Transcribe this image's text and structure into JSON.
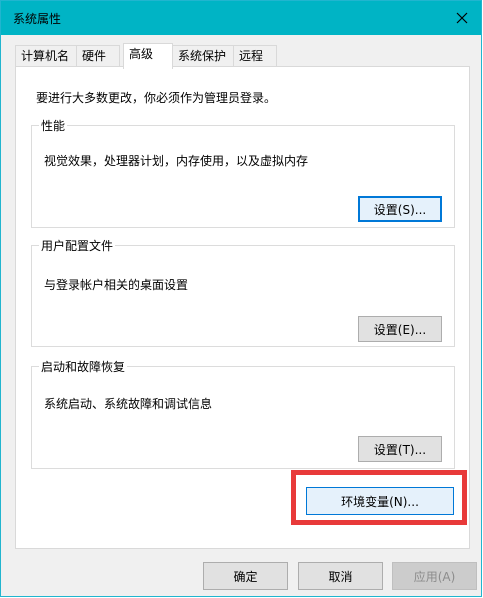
{
  "window": {
    "title": "系统属性"
  },
  "tabs": [
    {
      "label": "计算机名"
    },
    {
      "label": "硬件"
    },
    {
      "label": "高级"
    },
    {
      "label": "系统保护"
    },
    {
      "label": "远程"
    }
  ],
  "panel": {
    "notice": "要进行大多数更改，你必须作为管理员登录。",
    "performance": {
      "title": "性能",
      "desc": "视觉效果，处理器计划，内存使用，以及虚拟内存",
      "button": "设置(S)..."
    },
    "profiles": {
      "title": "用户配置文件",
      "desc": "与登录帐户相关的桌面设置",
      "button": "设置(E)..."
    },
    "startup": {
      "title": "启动和故障恢复",
      "desc": "系统启动、系统故障和调试信息",
      "button": "设置(T)..."
    },
    "env_button": "环境变量(N)..."
  },
  "footer": {
    "ok": "确定",
    "cancel": "取消",
    "apply": "应用(A)"
  },
  "colors": {
    "titlebar": "#00b4c5",
    "highlight": "#e83a3a",
    "focus": "#0078d7"
  }
}
